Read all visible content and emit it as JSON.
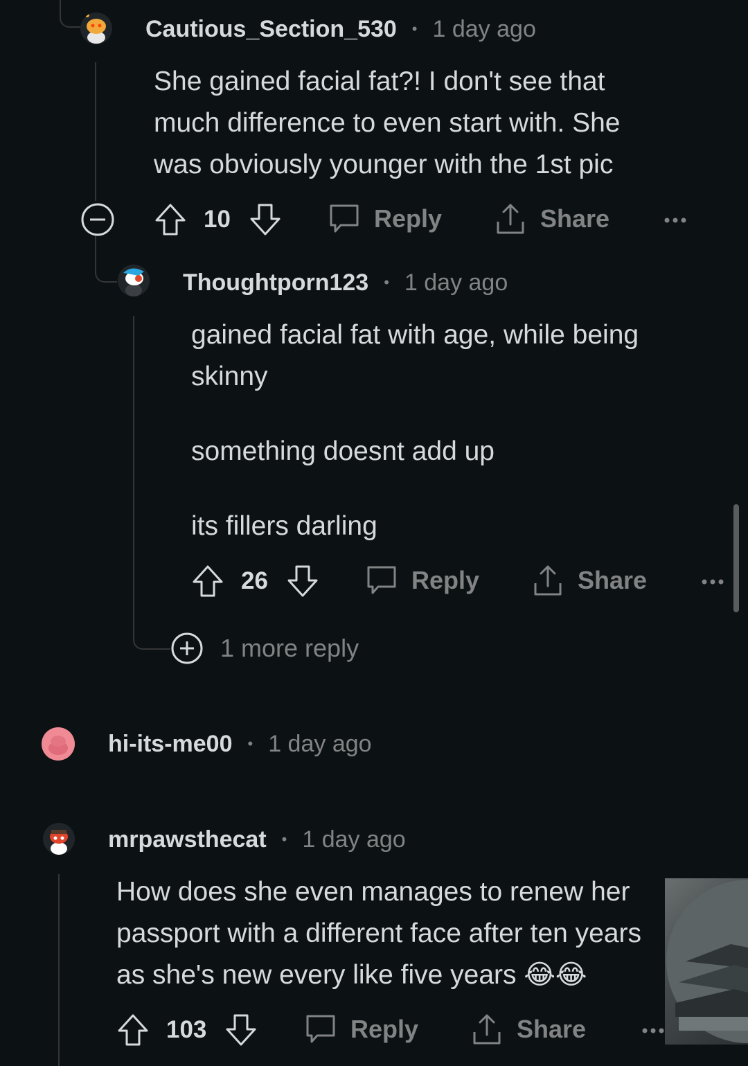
{
  "comments": [
    {
      "username": "Cautious_Section_530",
      "time": "1 day ago",
      "lines": [
        "She gained facial fat?! I don't see that",
        "much difference to even start with. She",
        "was obviously younger with the 1st pic"
      ],
      "votes": "10"
    },
    {
      "username": "Thoughtporn123",
      "time": "1 day ago",
      "lines": [
        "gained facial fat with age, while being",
        "skinny",
        "something doesnt add up",
        "its fillers darling"
      ],
      "votes": "26",
      "more_replies": "1 more reply"
    },
    {
      "username": "hi-its-me00",
      "time": "1 day ago"
    },
    {
      "username": "mrpawsthecat",
      "time": "1 day ago",
      "lines": [
        "How does she even manages to renew her",
        "passport with a different face after ten years",
        "as she's new every like five years 😂😂"
      ],
      "votes": "103"
    }
  ],
  "actions": {
    "reply": "Reply",
    "share": "Share",
    "separator": "•"
  },
  "icons": {
    "collapse": "minus-circle-icon",
    "upvote": "arrow-up-icon",
    "downvote": "arrow-down-icon",
    "reply": "speech-bubble-icon",
    "share": "share-upload-icon",
    "overflow": "more-dots-icon",
    "expand": "plus-circle-icon"
  },
  "colors": {
    "background": "#0c1214",
    "text": "#d7dadc",
    "muted": "#818384",
    "thread_line": "#343536"
  }
}
